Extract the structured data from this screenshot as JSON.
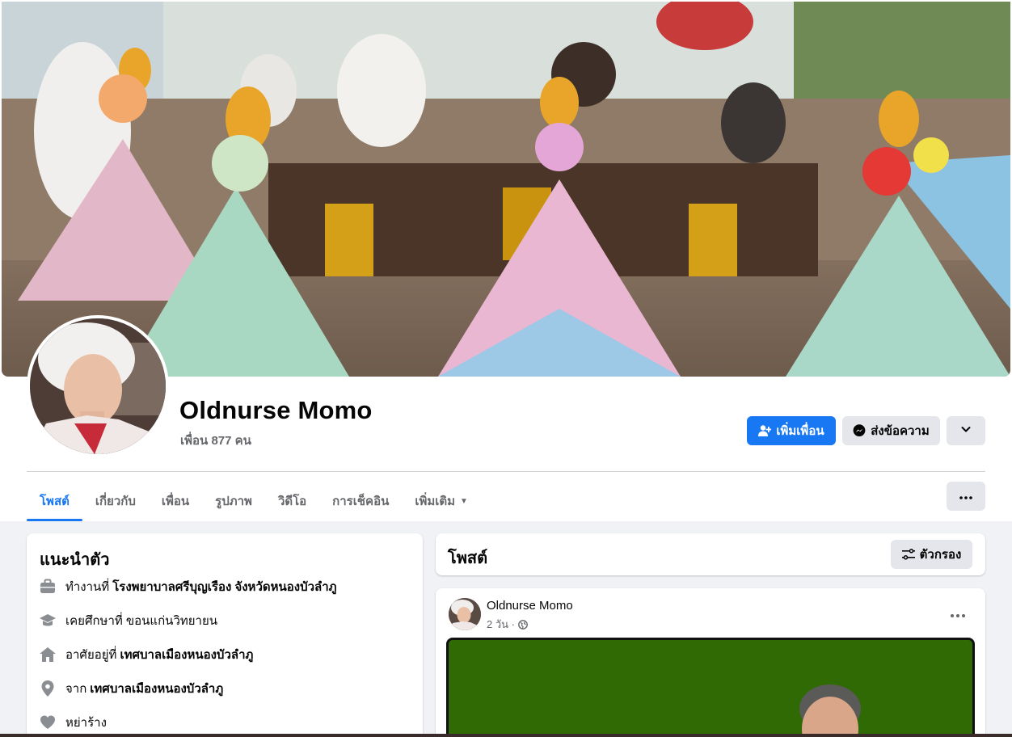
{
  "cover": {
    "alt": ""
  },
  "profile": {
    "name": "Oldnurse Momo",
    "friends": "เพื่อน 877 คน"
  },
  "actions": {
    "add_friend": "เพิ่มเพื่อน",
    "message": "ส่งข้อความ",
    "more_icon": "chevron-down-icon"
  },
  "tabs": [
    {
      "label": "โพสต์",
      "active": true
    },
    {
      "label": "เกี่ยวกับ"
    },
    {
      "label": "เพื่อน"
    },
    {
      "label": "รูปภาพ"
    },
    {
      "label": "วิดีโอ"
    },
    {
      "label": "การเช็คอิน"
    },
    {
      "label": "เพิ่มเติม"
    }
  ],
  "intro": {
    "title": "แนะนำตัว",
    "items": [
      {
        "icon": "briefcase-icon",
        "prefix": "ทำงานที่",
        "value": "โรงพยาบาลศรีบุญเรือง จังหวัดหนองบัวลำภู"
      },
      {
        "icon": "graduation-cap-icon",
        "prefix": "เคยศึกษาที่ ขอนแก่นวิทยายน",
        "value": ""
      },
      {
        "icon": "home-icon",
        "prefix": "อาศัยอยู่ที่",
        "value": "เทศบาลเมืองหนองบัวลำภู"
      },
      {
        "icon": "location-pin-icon",
        "prefix": "จาก",
        "value": "เทศบาลเมืองหนองบัวลำภู"
      },
      {
        "icon": "heart-icon",
        "prefix": "หย่าร้าง",
        "value": ""
      }
    ]
  },
  "posts": {
    "title": "โพสต์",
    "filter_label": "ตัวกรอง",
    "items": [
      {
        "author": "Oldnurse Momo",
        "time": "2 วัน ·"
      }
    ]
  },
  "colors": {
    "accent": "#1877f2",
    "secondary_button": "#e4e6eb",
    "page_bg": "#f0f2f5",
    "media_bg": "#2f6a05"
  }
}
